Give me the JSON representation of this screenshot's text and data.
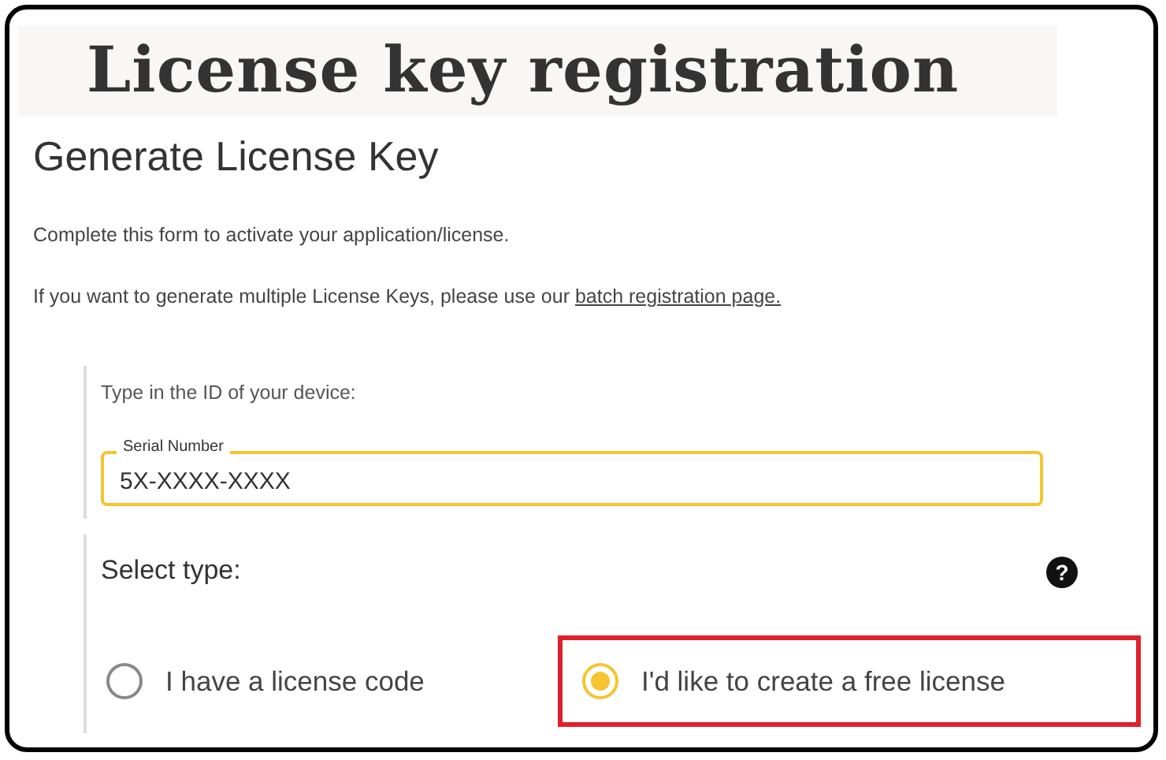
{
  "banner": {
    "title": "License key registration"
  },
  "heading": "Generate License Key",
  "intro": "Complete this form to activate your application/license.",
  "batch_note": {
    "text": "If you want to generate multiple License Keys, please use our ",
    "link": "batch registration page."
  },
  "device_section": {
    "label": "Type in the ID of your device:",
    "field": {
      "label": "Serial Number",
      "value": "5X-XXXX-XXXX"
    }
  },
  "type_section": {
    "label": "Select type:",
    "help": "?",
    "options": [
      {
        "label": "I have a license code",
        "selected": false,
        "highlighted": false
      },
      {
        "label": "I'd like to create a free license",
        "selected": true,
        "highlighted": true
      }
    ]
  }
}
